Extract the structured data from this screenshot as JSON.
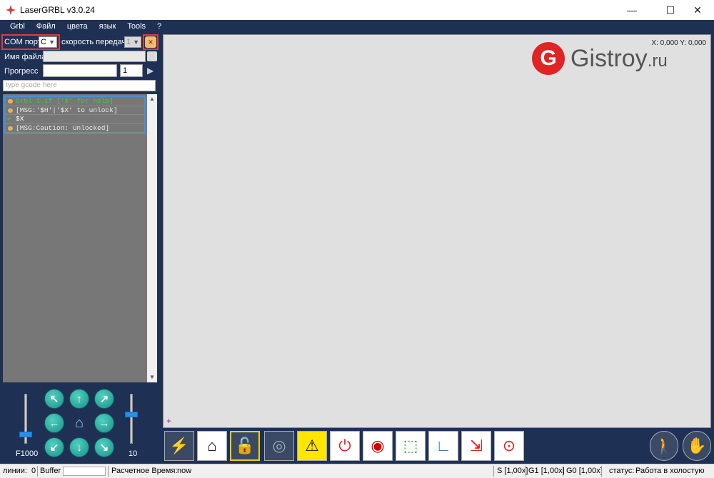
{
  "window": {
    "title": "LaserGRBL v3.0.24",
    "minimize": "—",
    "maximize": "☐",
    "close": "✕"
  },
  "menu": [
    "Grbl",
    "Файл",
    "цвета",
    "язык",
    "Tools",
    "?"
  ],
  "connection": {
    "com_label": "COM порт",
    "com_value": "C",
    "speed_label": "скорость передачи",
    "speed_value": "1"
  },
  "file": {
    "name_label": "Имя файла",
    "progress_label": "Прогресс",
    "copies_value": "1"
  },
  "gcode_placeholder": "type gcode here",
  "console": [
    {
      "text": "Grbl 1.1f ['$' for help]",
      "color": "#3ecf3e",
      "icon": "dot"
    },
    {
      "text": "[MSG:'$H'|'$X' to unlock]",
      "color": "#eaeaea",
      "icon": "dot"
    },
    {
      "text": "$X",
      "color": "#ffffff",
      "icon": "check"
    },
    {
      "text": "[MSG:Caution: Unlocked]",
      "color": "#eaeaea",
      "icon": "dot"
    }
  ],
  "jog": {
    "feed_label": "F1000",
    "step_label": "10",
    "feed_level": 0.2,
    "step_level": 0.6
  },
  "canvas": {
    "coords": "X: 0,000 Y: 0,000"
  },
  "logo": {
    "mark": "G",
    "name": "Gistroy",
    "suffix": ".ru"
  },
  "toolbar_icons": [
    "lightning-icon",
    "home-magnify-icon",
    "unlock-icon",
    "globe-icon",
    "laser-warning-icon",
    "stop-icon",
    "target-icon",
    "frame-icon",
    "axis-icon",
    "resize-icon",
    "record-icon"
  ],
  "status": {
    "lines_label": "линии:",
    "lines_value": "0",
    "buffer_label": "Buffer",
    "time_label": "Расчетное Время:",
    "time_value": "now",
    "s_override": "S [1,00x]",
    "g1_override": "G1 [1,00x]",
    "g0_override": "G0 [1,00x]",
    "state_label": "статус:",
    "state_value": "Работа в холостую"
  },
  "colors": {
    "panel": "#1e3155",
    "highlight": "#e23b3b",
    "console_border": "#4a90d9",
    "jog": "#1d8e88"
  }
}
